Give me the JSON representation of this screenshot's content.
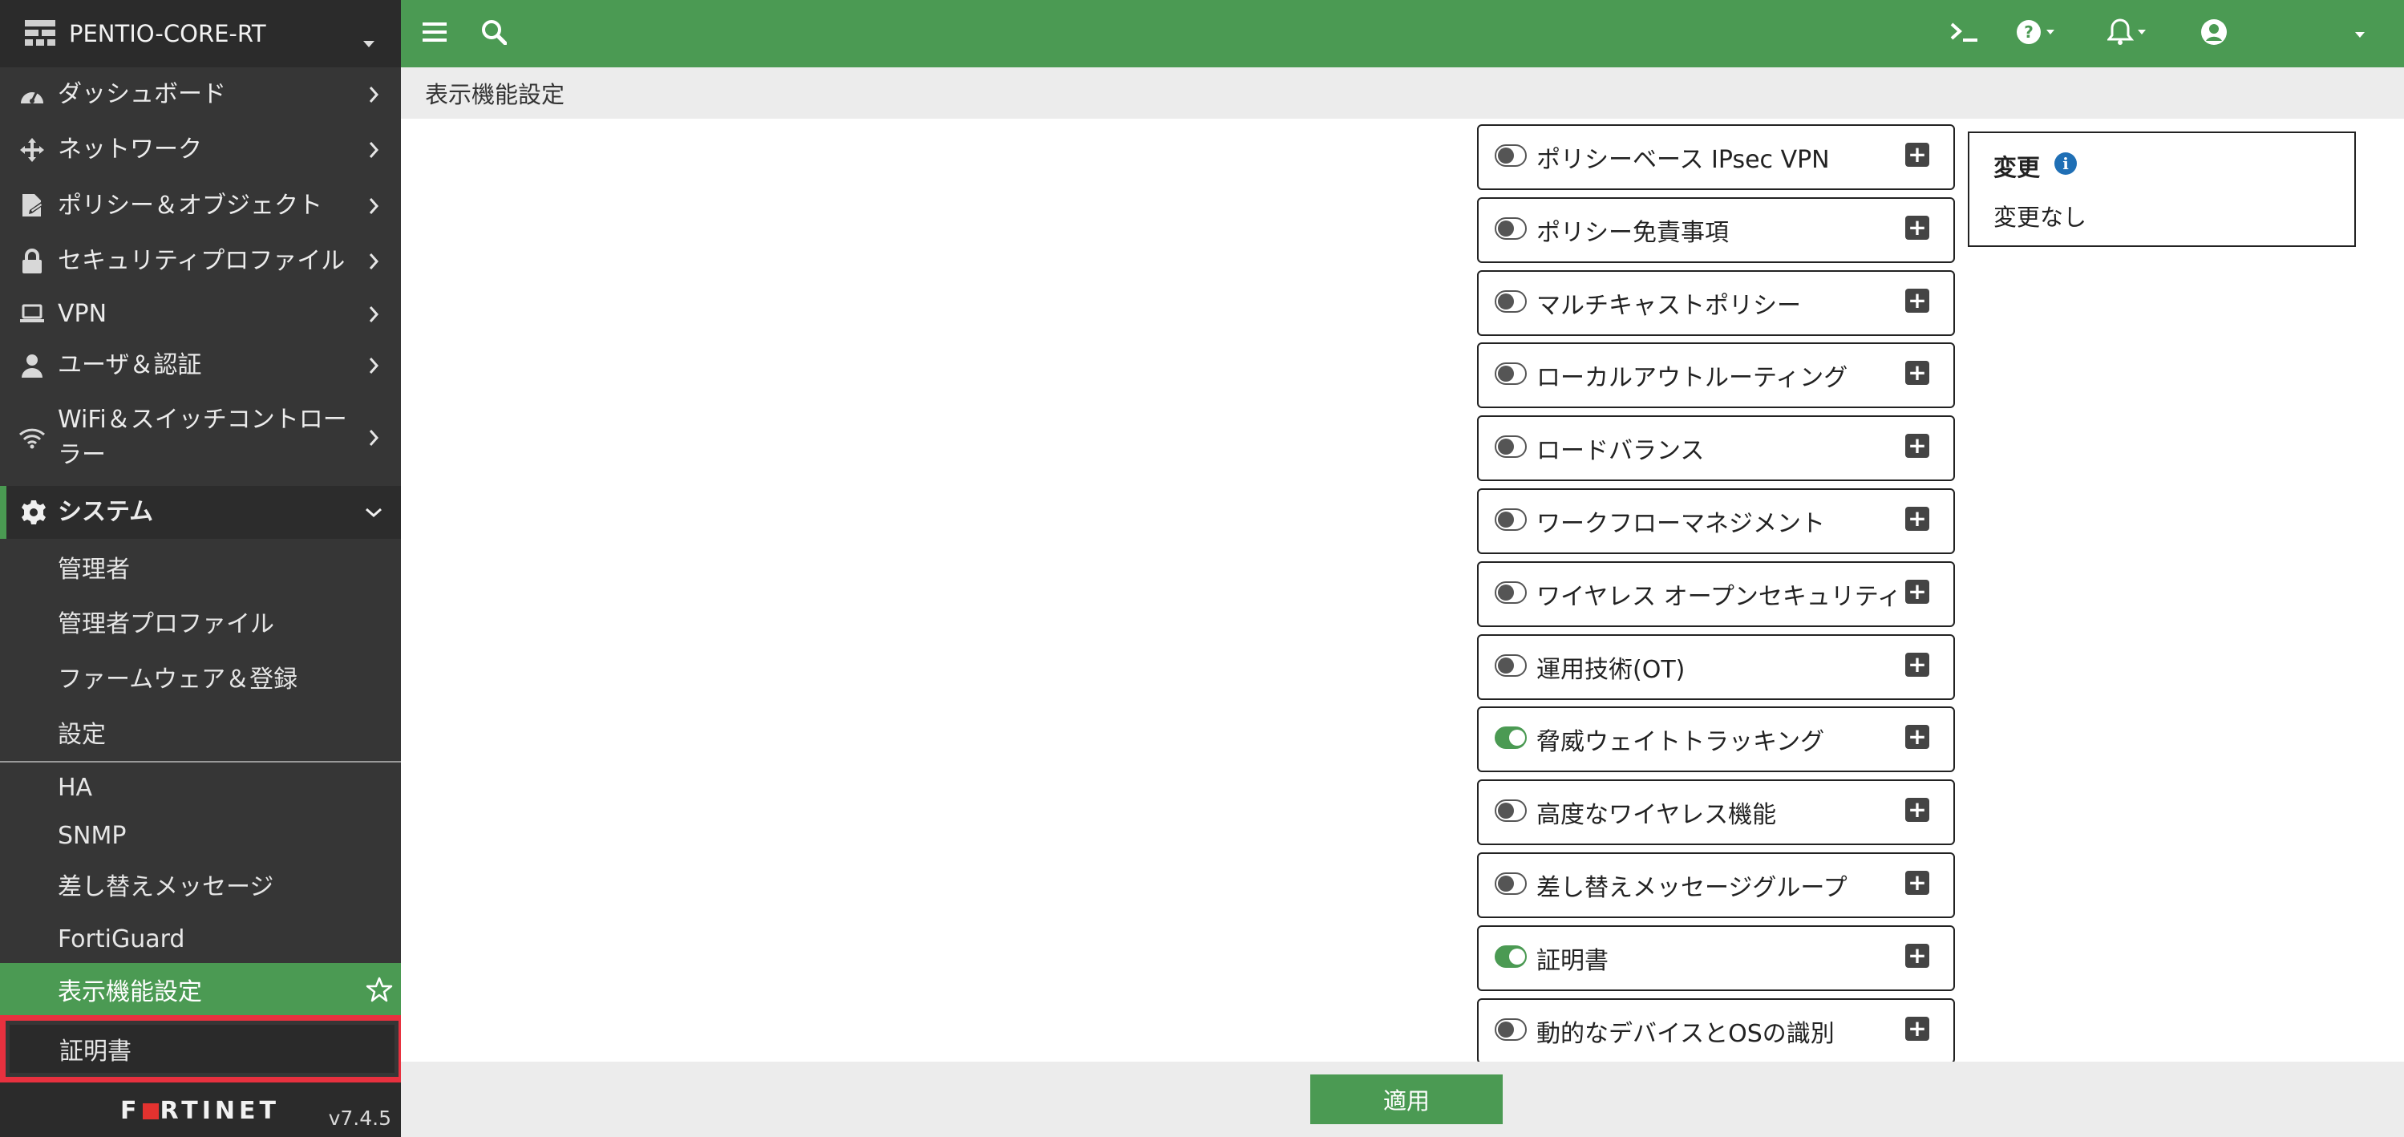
{
  "device": {
    "name": "PENTIO-CORE-RT"
  },
  "sidebar": {
    "items": [
      {
        "label": "ダッシュボード",
        "icon": "dashboard-icon"
      },
      {
        "label": "ネットワーク",
        "icon": "network-icon"
      },
      {
        "label": "ポリシー＆オブジェクト",
        "icon": "policy-icon"
      },
      {
        "label": "セキュリティプロファイル",
        "icon": "lock-icon"
      },
      {
        "label": "VPN",
        "icon": "laptop-icon"
      },
      {
        "label": "ユーザ＆認証",
        "icon": "user-icon"
      },
      {
        "label": "WiFi＆スイッチコントローラー",
        "icon": "wifi-icon"
      }
    ],
    "system": {
      "label": "システム",
      "icon": "gear-icon",
      "children": [
        "管理者",
        "管理者プロファイル",
        "ファームウェア＆登録",
        "設定",
        "HA",
        "SNMP",
        "差し替えメッセージ",
        "FortiGuard",
        "表示機能設定",
        "証明書"
      ]
    },
    "brand": "FORTINET",
    "version": "v7.4.5"
  },
  "breadcrumb": "表示機能設定",
  "features": [
    {
      "label": "ポリシーベース IPsec VPN",
      "enabled": false
    },
    {
      "label": "ポリシー免責事項",
      "enabled": false
    },
    {
      "label": "マルチキャストポリシー",
      "enabled": false
    },
    {
      "label": "ローカルアウトルーティング",
      "enabled": false
    },
    {
      "label": "ロードバランス",
      "enabled": false
    },
    {
      "label": "ワークフローマネジメント",
      "enabled": false
    },
    {
      "label": "ワイヤレス オープンセキュリティ",
      "enabled": false
    },
    {
      "label": "運用技術(OT)",
      "enabled": false
    },
    {
      "label": "脅威ウェイトトラッキング",
      "enabled": true
    },
    {
      "label": "高度なワイヤレス機能",
      "enabled": false
    },
    {
      "label": "差し替えメッセージグループ",
      "enabled": false
    },
    {
      "label": "証明書",
      "enabled": true
    },
    {
      "label": "動的なデバイスとOSの識別",
      "enabled": false
    }
  ],
  "changes": {
    "title": "変更",
    "body": "変更なし"
  },
  "actions": {
    "apply_label": "適用"
  },
  "colors": {
    "accent": "#4b9a53",
    "sidebar": "#363636",
    "highlight": "#e8313f",
    "info": "#1f6fb5"
  }
}
